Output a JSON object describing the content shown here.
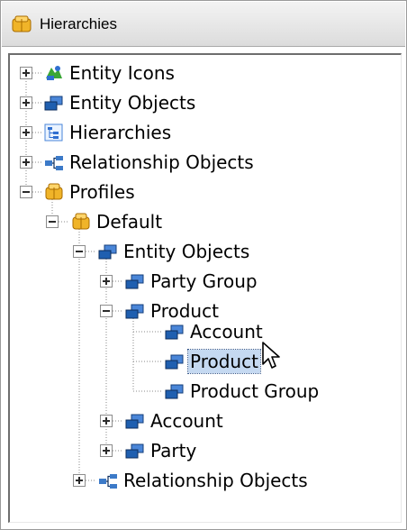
{
  "window": {
    "title": "Hierarchies",
    "title_icon": "profile-cube-icon"
  },
  "tree": {
    "nodes": [
      {
        "label": "Entity Icons",
        "icon": "entity-icons-icon",
        "expander": "plus"
      },
      {
        "label": "Entity Objects",
        "icon": "entity-object-icon",
        "expander": "plus"
      },
      {
        "label": "Hierarchies",
        "icon": "hierarchies-icon",
        "expander": "plus"
      },
      {
        "label": "Relationship Objects",
        "icon": "relationship-icon",
        "expander": "plus"
      },
      {
        "label": "Profiles",
        "icon": "profile-cube-icon",
        "expander": "minus"
      },
      {
        "label": "Default",
        "icon": "profile-cube-icon",
        "expander": "minus"
      },
      {
        "label": "Entity Objects",
        "icon": "entity-object-icon",
        "expander": "minus"
      },
      {
        "label": "Party Group",
        "icon": "entity-object-icon",
        "expander": "plus"
      },
      {
        "label": "Product",
        "icon": "entity-object-icon",
        "expander": "minus"
      },
      {
        "label": "Account",
        "icon": "entity-object-icon",
        "expander": "none"
      },
      {
        "label": "Product",
        "icon": "entity-object-icon",
        "expander": "none",
        "selected": true
      },
      {
        "label": "Product Group",
        "icon": "entity-object-icon",
        "expander": "none"
      },
      {
        "label": "Account",
        "icon": "entity-object-icon",
        "expander": "plus"
      },
      {
        "label": "Party",
        "icon": "entity-object-icon",
        "expander": "plus"
      },
      {
        "label": "Relationship Objects",
        "icon": "relationship-icon",
        "expander": "plus"
      }
    ]
  },
  "colors": {
    "selection_bg": "#c5d9f1",
    "entity_icon": "#1f5fb0",
    "profile_icon": "#e8a317",
    "relationship_icon": "#3c7ac8",
    "entity_icons_green": "#3aa635"
  }
}
